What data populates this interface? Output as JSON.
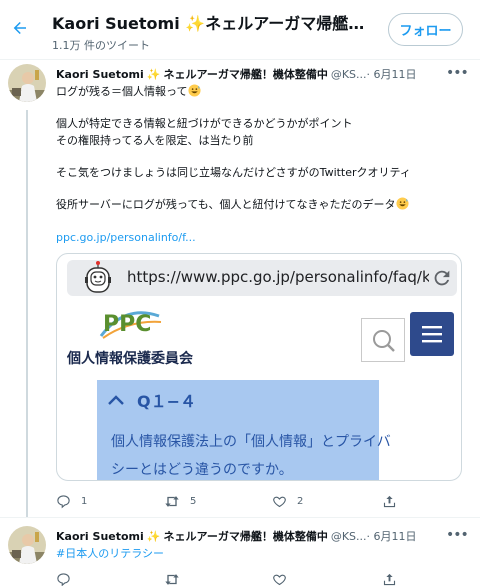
{
  "header": {
    "title": "Kaori Suetomi ✨ネェルアーガマ帰艦！機体整備中",
    "subtitle": "1.1万 件のツイート",
    "follow_label": "フォロー"
  },
  "tweets": [
    {
      "name": "Kaori Suetomi",
      "badge": "✨",
      "display_suffix": "ネェルアーガマ帰艦！機体整備中",
      "handle": "@KS...",
      "date": "· 6月11日",
      "lines": [
        "ログが残る＝個人情報って",
        "個人が特定できる情報と紐づけができるかどうかがポイント",
        "その権限持ってる人を限定、は当たり前",
        "そこ気をつけましょうは同じ立場なんだけどさすがのTwitterクオリティ",
        "役所サーバーにログが残っても、個人と紐付けてなきゃただのデータ"
      ],
      "link": "ppc.go.jp/personalinfo/f...",
      "card": {
        "url": "https://www.ppc.go.jp/personalinfo/faq/ko...",
        "logo_text": "PPC",
        "org_name": "個人情報保護委員会",
        "faq_heading": "Q１−４",
        "faq_lines": [
          "個人情報保護法上の「個人情報」とプライバ",
          "シーとはどう違うのですか。"
        ]
      },
      "reply_count": "1",
      "retweet_count": "5",
      "like_count": "2",
      "share_count": ""
    },
    {
      "name": "Kaori Suetomi",
      "badge": "✨",
      "display_suffix": "ネェルアーガマ帰艦！機体整備中",
      "handle": "@KS...",
      "date": "· 6月11日",
      "hashtag": "#日本人のリテラシー"
    }
  ],
  "colors": {
    "accent": "#1d9bf0",
    "text": "#0f1419",
    "muted": "#536471",
    "ppc_navy": "#2e4a8c",
    "faq_bg": "#a8c8f0"
  },
  "icons": {
    "back": "arrow-left-icon",
    "reply": "speech-bubble-icon",
    "retweet": "retweet-icon",
    "like": "heart-icon",
    "share": "share-icon"
  }
}
